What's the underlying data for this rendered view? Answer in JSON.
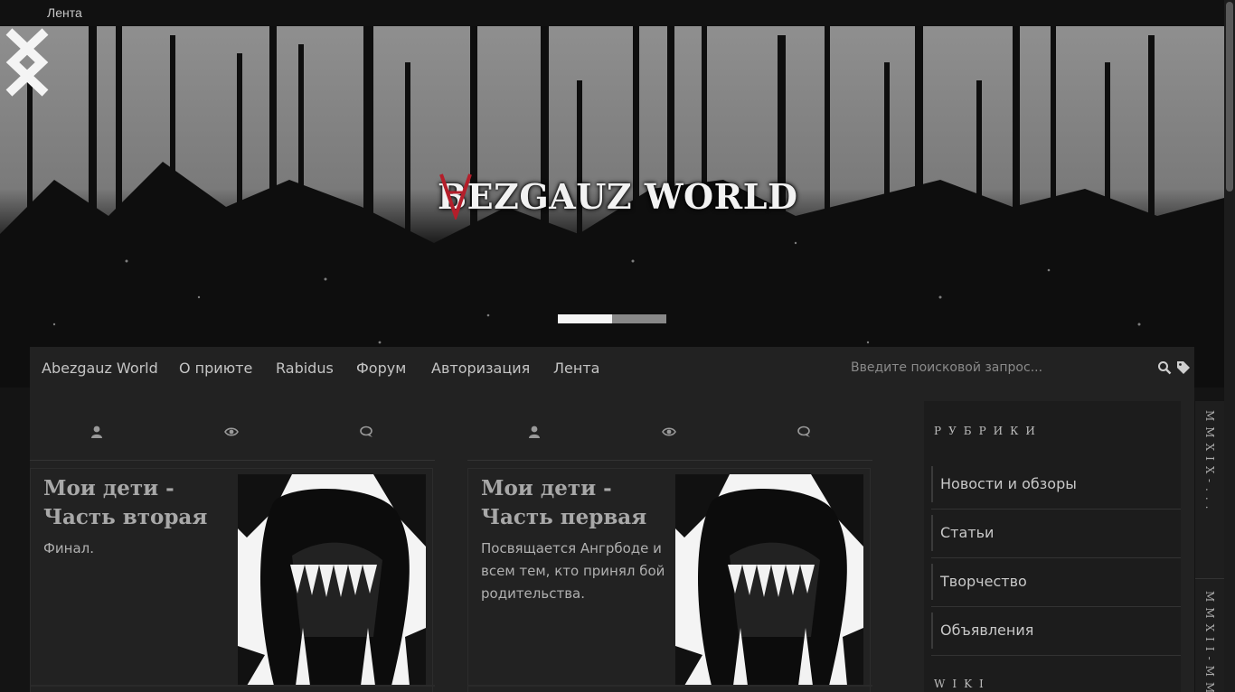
{
  "topbar": {
    "link": "Лента"
  },
  "hero": {
    "logo_text": "BEZGAUZ WORLD",
    "logo_letter": "A",
    "slider": {
      "slides": 2,
      "active": 1
    }
  },
  "nav": {
    "items": [
      "Abezgauz World",
      "О приюте",
      "Rabidus",
      "Форум",
      "Авторизация",
      "Лента"
    ],
    "search_placeholder": "Введите поисковой запрос..."
  },
  "posts": [
    {
      "title": "Мои дети - Часть вторая",
      "excerpt": "Финал."
    },
    {
      "title": "Мои дети - Часть первая",
      "excerpt": "Посвящается Ангрбоде и всем тем, кто принял бой родительства."
    }
  ],
  "sidebar": {
    "heading": "РУБРИКИ",
    "items": [
      "Новости и обзоры",
      "Статьи",
      "Творчество",
      "Объявления"
    ],
    "heading2": "WIKI"
  },
  "vstrip": {
    "top": "MMXIX-...",
    "bottom": "MMXII-MMX"
  },
  "icons": [
    "user-icon",
    "eye-icon",
    "comments-icon",
    "search-icon",
    "tag-icon",
    "chevron-left-icon",
    "chevron-right-icon"
  ],
  "colors": {
    "accent": "#b41e2a",
    "background": "#222222",
    "topbar": "#111111"
  }
}
